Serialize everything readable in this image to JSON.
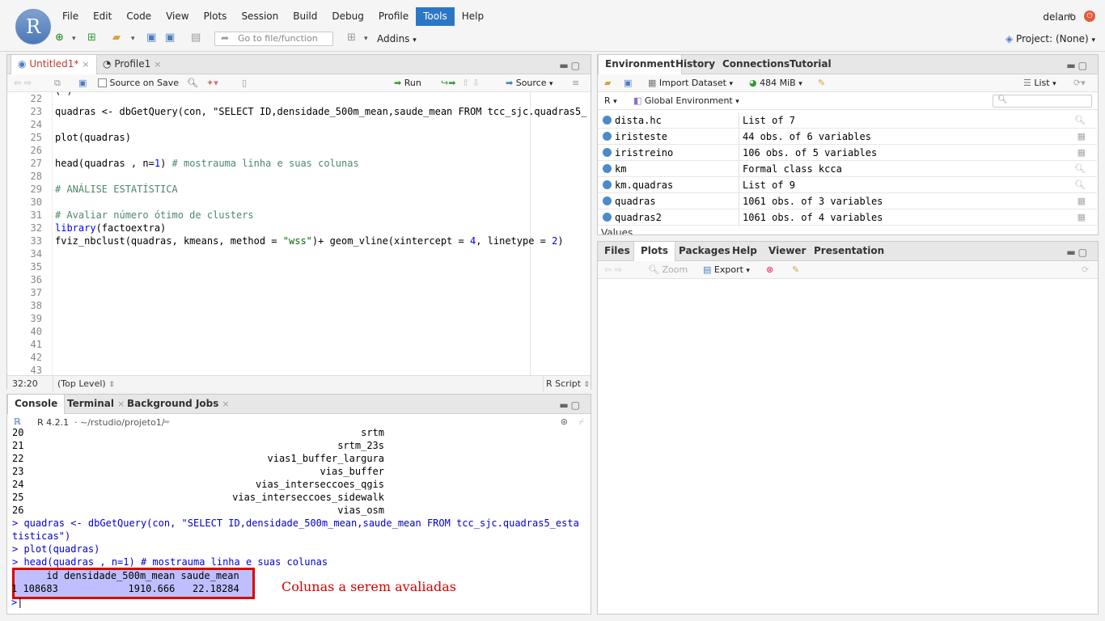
{
  "app": {
    "logo_letter": "R"
  },
  "menu": [
    "File",
    "Edit",
    "Code",
    "View",
    "Plots",
    "Session",
    "Build",
    "Debug",
    "Profile",
    "Tools",
    "Help"
  ],
  "menu_active": "Tools",
  "user": "delano",
  "toolbar": {
    "goto_placeholder": "Go to file/function",
    "addins": "Addins",
    "project": "Project: (None)"
  },
  "editor": {
    "tabs": [
      "Untitled1*",
      "Profile1"
    ],
    "source_on_save": "Source on Save",
    "run": "Run",
    "source": "Source",
    "lines": [
      {
        "n": "22",
        "code": ""
      },
      {
        "n": "23",
        "code": "quadras <- dbGetQuery(con, \"SELECT ID,densidade_500m_mean,saude_mean FROM tcc_sjc.quadras5_"
      },
      {
        "n": "24",
        "code": ""
      },
      {
        "n": "25",
        "code": "plot(quadras)"
      },
      {
        "n": "26",
        "code": ""
      },
      {
        "n": "27",
        "code": "head(quadras , n=1) # mostrauma linha e suas colunas"
      },
      {
        "n": "28",
        "code": ""
      },
      {
        "n": "29",
        "code": "# ANÁLISE ESTATÍSTICA"
      },
      {
        "n": "30",
        "code": ""
      },
      {
        "n": "31",
        "code": "# Avaliar número ótimo de clusters"
      },
      {
        "n": "32",
        "code": "library(factoextra)"
      },
      {
        "n": "33",
        "code": "fviz_nbclust(quadras, kmeans, method = \"wss\")+ geom_vline(xintercept = 4, linetype = 2)"
      },
      {
        "n": "34",
        "code": ""
      },
      {
        "n": "35",
        "code": ""
      },
      {
        "n": "36",
        "code": ""
      },
      {
        "n": "37",
        "code": ""
      },
      {
        "n": "38",
        "code": ""
      },
      {
        "n": "39",
        "code": ""
      },
      {
        "n": "40",
        "code": ""
      },
      {
        "n": "41",
        "code": ""
      },
      {
        "n": "42",
        "code": ""
      },
      {
        "n": "43",
        "code": ""
      }
    ],
    "status_pos": "32:20",
    "status_scope": "(Top Level)",
    "status_type": "R Script"
  },
  "console": {
    "tabs": [
      "Console",
      "Terminal",
      "Background Jobs"
    ],
    "version": "R 4.2.1",
    "path": "~/rstudio/projeto1/",
    "lines": [
      {
        "n": "20",
        "val": "srtm"
      },
      {
        "n": "21",
        "val": "srtm_23s"
      },
      {
        "n": "22",
        "val": "vias1_buffer_largura"
      },
      {
        "n": "23",
        "val": "vias_buffer"
      },
      {
        "n": "24",
        "val": "vias_interseccoes_qgis"
      },
      {
        "n": "25",
        "val": "vias_interseccoes_sidewalk"
      },
      {
        "n": "26",
        "val": "vias_osm"
      }
    ],
    "cmd1a": "> quadras <- dbGetQuery(con, \"SELECT ID,densidade_500m_mean,saude_mean FROM tcc_sjc.quadras5_esta",
    "cmd1b": "tisticas\")",
    "cmd2": "> plot(quadras)",
    "cmd3": "> head(quadras , n=1) # mostrauma linha e suas colunas",
    "out_header": "      id densidade_500m_mean saude_mean",
    "out_row": "1 108683            1910.666   22.18284",
    "prompt": ">",
    "annotation": "Colunas a serem avaliadas"
  },
  "env": {
    "tabs": [
      "Environment",
      "History",
      "Connections",
      "Tutorial"
    ],
    "import": "Import Dataset",
    "memory": "484 MiB",
    "list": "List",
    "lang": "R",
    "scope": "Global Environment",
    "rows": [
      {
        "name": "dista.hc",
        "value": "List of  7",
        "icon": "search-icon"
      },
      {
        "name": "iristeste",
        "value": "44 obs. of 6 variables",
        "icon": "grid-icon"
      },
      {
        "name": "iristreino",
        "value": "106 obs. of 5 variables",
        "icon": "grid-icon"
      },
      {
        "name": "km",
        "value": "Formal class  kcca",
        "icon": "search-icon"
      },
      {
        "name": "km.quadras",
        "value": "List of  9",
        "icon": "search-icon"
      },
      {
        "name": "quadras",
        "value": "1061 obs. of 3 variables",
        "icon": "grid-icon"
      },
      {
        "name": "quadras2",
        "value": "1061 obs. of 4 variables",
        "icon": "grid-icon"
      }
    ],
    "values_label": "Values"
  },
  "files": {
    "tabs": [
      "Files",
      "Plots",
      "Packages",
      "Help",
      "Viewer",
      "Presentation"
    ],
    "zoom": "Zoom",
    "export": "Export"
  }
}
